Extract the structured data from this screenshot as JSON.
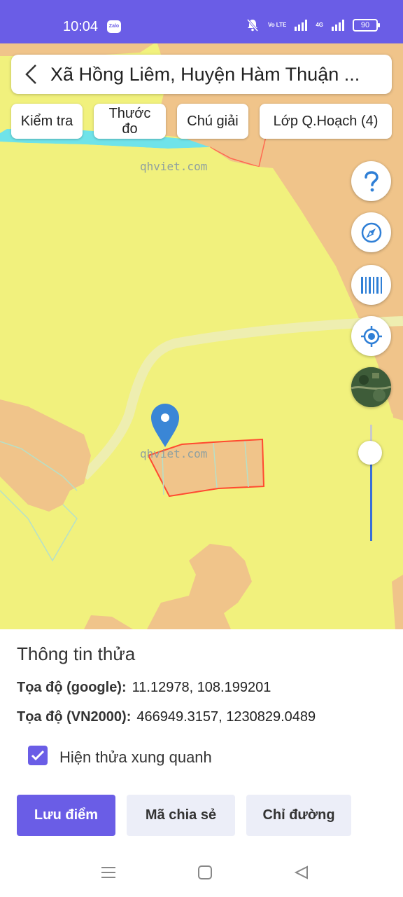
{
  "status_bar": {
    "time": "10:04",
    "notification_app": "Zalo",
    "volte": "Vo LTE",
    "network": "4G",
    "battery": "90"
  },
  "header": {
    "title": "Xã Hồng Liêm, Huyện Hàm Thuận ..."
  },
  "toolbar": {
    "check": "Kiểm tra",
    "measure": "Thước đo",
    "legend": "Chú giải",
    "planning_layers": "Lớp Q.Hoạch (4)"
  },
  "map": {
    "watermark": "qhviet.com",
    "zoom_level": 0.76,
    "colors": {
      "agricultural_land": "#f1f17d",
      "residential_land": "#f0c48a",
      "water": "#6fe3e9",
      "parcel_border": "#ff5a3c",
      "marker": "#3a86d6"
    }
  },
  "map_controls": {
    "help_icon": "question-icon",
    "compass_icon": "compass-icon",
    "barcode_icon": "barcode-icon",
    "locate_icon": "crosshair-icon",
    "satellite_icon": "satellite-thumbnail"
  },
  "panel": {
    "title": "Thông tin thửa",
    "google_label": "Tọa độ (google):",
    "google_value": "11.12978, 108.199201",
    "vn2000_label": "Tọa độ (VN2000):",
    "vn2000_value": "466949.3157, 1230829.0489",
    "show_neighbors_label": "Hiện thửa xung quanh",
    "show_neighbors_checked": true,
    "save_label": "Lưu điểm",
    "share_label": "Mã chia sẻ",
    "directions_label": "Chỉ đường"
  }
}
